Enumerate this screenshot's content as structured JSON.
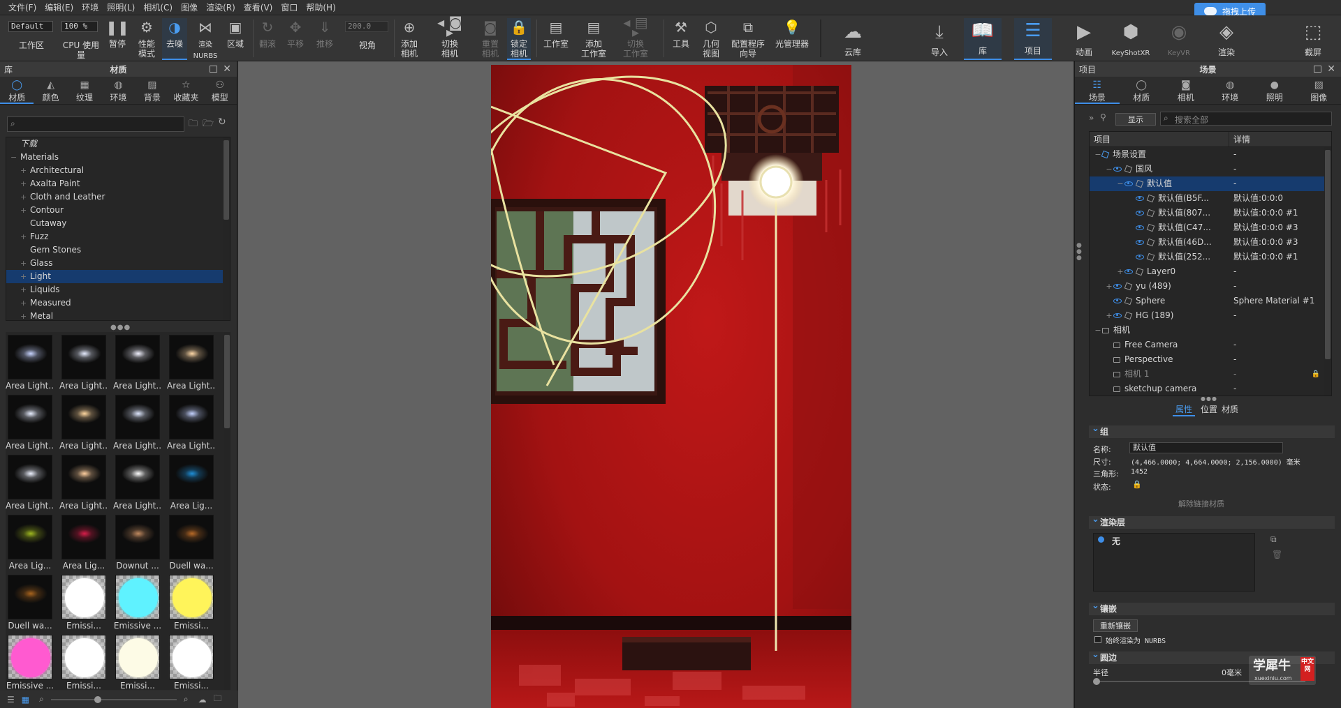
{
  "menu": [
    "文件(F)",
    "编辑(E)",
    "环境",
    "照明(L)",
    "相机(C)",
    "图像",
    "渲染(R)",
    "查看(V)",
    "窗口",
    "帮助(H)"
  ],
  "upload": {
    "label": "拖拽上传"
  },
  "toolbar": {
    "preset": "Default",
    "zoom": "100 %",
    "fov_value": "200.0",
    "items": {
      "workspace": "工作区",
      "cpu": "CPU 使用量",
      "pause": "暂停",
      "perf": "性能\n模式",
      "denoise": "去噪",
      "render_nurbs": "渲染\nNURBS",
      "region": "区域",
      "roll": "翻滚",
      "pan": "平移",
      "push": "推移",
      "fov": "视角",
      "add_cam": "添加\n相机",
      "switch_cam": "切换\n相机",
      "reset_cam": "重置\n相机",
      "lock_cam": "锁定\n相机",
      "studio": "工作室",
      "add_studio": "添加\n工作室",
      "switch_studio": "切换\n工作室",
      "tools": "工具",
      "geo_view": "几何\n视图",
      "config": "配置程序\n向导",
      "light_mgr": "光管理器",
      "cloud": "云库",
      "import": "导入",
      "library": "库",
      "project": "项目",
      "anim": "动画",
      "keyshotxr": "KeyShotXR",
      "keyvr": "KeyVR",
      "render": "渲染",
      "screenshot": "截屏"
    }
  },
  "library": {
    "title": "材质",
    "panel": "库",
    "tabs": [
      "材质",
      "颜色",
      "纹理",
      "环境",
      "背景",
      "收藏夹",
      "模型"
    ],
    "tree": [
      {
        "label": "下载",
        "exp": "",
        "ital": true
      },
      {
        "label": "Materials",
        "exp": "−",
        "ital": false
      },
      {
        "label": "Architectural",
        "exp": "+",
        "indent": 1
      },
      {
        "label": "Axalta Paint",
        "exp": "+",
        "indent": 1
      },
      {
        "label": "Cloth and Leather",
        "exp": "+",
        "indent": 1
      },
      {
        "label": "Contour",
        "exp": "+",
        "indent": 1
      },
      {
        "label": "Cutaway",
        "exp": "",
        "indent": 1
      },
      {
        "label": "Fuzz",
        "exp": "+",
        "indent": 1
      },
      {
        "label": "Gem Stones",
        "exp": "",
        "indent": 1
      },
      {
        "label": "Glass",
        "exp": "+",
        "indent": 1
      },
      {
        "label": "Light",
        "exp": "+",
        "indent": 1,
        "sel": true
      },
      {
        "label": "Liquids",
        "exp": "+",
        "indent": 1
      },
      {
        "label": "Measured",
        "exp": "+",
        "indent": 1
      },
      {
        "label": "Metal",
        "exp": "+",
        "indent": 1
      }
    ],
    "thumbs": [
      {
        "label": "Area Light...",
        "kind": "glow",
        "color": "#c8d4ff"
      },
      {
        "label": "Area Light...",
        "kind": "glow",
        "color": "#e6ecff"
      },
      {
        "label": "Area Light...",
        "kind": "glow",
        "color": "#f2f2ff"
      },
      {
        "label": "Area Light...",
        "kind": "glow",
        "color": "#ffd9a8"
      },
      {
        "label": "Area Light...",
        "kind": "glow",
        "color": "#e8eeff"
      },
      {
        "label": "Area Light...",
        "kind": "glow",
        "color": "#ffd7a0"
      },
      {
        "label": "Area Light...",
        "kind": "glow",
        "color": "#dfe8ff"
      },
      {
        "label": "Area Light...",
        "kind": "glow",
        "color": "#c4d2ff"
      },
      {
        "label": "Area Light...",
        "kind": "glow",
        "color": "#eef2ff"
      },
      {
        "label": "Area Light...",
        "kind": "glow",
        "color": "#ffd0a0"
      },
      {
        "label": "Area Light...",
        "kind": "glow",
        "color": "#ffffff"
      },
      {
        "label": "Area Lig...",
        "kind": "glow",
        "color": "#1f8fd8"
      },
      {
        "label": "Area Lig...",
        "kind": "glow",
        "color": "#9fb820"
      },
      {
        "label": "Area Lig...",
        "kind": "glow",
        "color": "#d81e4a"
      },
      {
        "label": "Downut ...",
        "kind": "glow",
        "color": "#c08a60"
      },
      {
        "label": "Duell wa...",
        "kind": "glow",
        "color": "#b86a28"
      },
      {
        "label": "Duell wa...",
        "kind": "glow",
        "color": "#a8641e"
      },
      {
        "label": "Emissi...",
        "kind": "ball",
        "color": "#ffffff"
      },
      {
        "label": "Emissive ...",
        "kind": "ball",
        "color": "#5ff2ff"
      },
      {
        "label": "Emissi...",
        "kind": "ball",
        "color": "#fff45a"
      },
      {
        "label": "Emissive ...",
        "kind": "ball",
        "color": "#ff5ad0"
      },
      {
        "label": "Emissi...",
        "kind": "ball",
        "color": "#ffffff"
      },
      {
        "label": "Emissi...",
        "kind": "ball",
        "color": "#fdfbe6"
      },
      {
        "label": "Emissi...",
        "kind": "ball",
        "color": "#ffffff"
      }
    ]
  },
  "project": {
    "panel": "项目",
    "title": "场景",
    "tabs": [
      "场景",
      "材质",
      "相机",
      "环境",
      "照明",
      "图像"
    ],
    "display": "显示",
    "search_placeholder": "搜索全部",
    "col1": "项目",
    "col2": "详情",
    "rows": [
      {
        "indent": 0,
        "pm": "−",
        "icon": "scene",
        "label": "场景设置",
        "detail": "-"
      },
      {
        "indent": 1,
        "pm": "−",
        "icon": "eye",
        "label": "国风",
        "detail": "-"
      },
      {
        "indent": 2,
        "pm": "−",
        "icon": "eye",
        "label": "默认值",
        "detail": "-",
        "sel": true
      },
      {
        "indent": 3,
        "pm": "",
        "icon": "eye",
        "label": "默认值(B5F...",
        "detail": "默认值:0:0:0"
      },
      {
        "indent": 3,
        "pm": "",
        "icon": "eye",
        "label": "默认值(807...",
        "detail": "默认值:0:0:0 #1"
      },
      {
        "indent": 3,
        "pm": "",
        "icon": "eye",
        "label": "默认值(C47...",
        "detail": "默认值:0:0:0 #3"
      },
      {
        "indent": 3,
        "pm": "",
        "icon": "eye",
        "label": "默认值(46D...",
        "detail": "默认值:0:0:0 #3"
      },
      {
        "indent": 3,
        "pm": "",
        "icon": "eye",
        "label": "默认值(252...",
        "detail": "默认值:0:0:0 #1"
      },
      {
        "indent": 2,
        "pm": "+",
        "icon": "eye",
        "label": "Layer0",
        "detail": "-"
      },
      {
        "indent": 1,
        "pm": "+",
        "icon": "eye",
        "label": "yu (489)",
        "detail": "-"
      },
      {
        "indent": 1,
        "pm": "",
        "icon": "eye",
        "label": "Sphere",
        "detail": "Sphere Material #1"
      },
      {
        "indent": 1,
        "pm": "+",
        "icon": "eye",
        "label": "HG (189)",
        "detail": "-"
      },
      {
        "indent": 0,
        "pm": "−",
        "icon": "cam",
        "label": "相机",
        "detail": ""
      },
      {
        "indent": 1,
        "pm": "",
        "icon": "cam",
        "label": "Free Camera",
        "detail": "-"
      },
      {
        "indent": 1,
        "pm": "",
        "icon": "cam",
        "label": "Perspective",
        "detail": "-"
      },
      {
        "indent": 1,
        "pm": "",
        "icon": "cam",
        "label": "相机 1",
        "detail": "-",
        "dim": true
      },
      {
        "indent": 1,
        "pm": "",
        "icon": "cam",
        "label": "sketchup camera",
        "detail": "-"
      }
    ],
    "subtabs": [
      "属性",
      "位置",
      "材质"
    ],
    "group": {
      "section": "组",
      "name_label": "名称:",
      "name_value": "默认值",
      "size_label": "尺寸:",
      "size_value": "(4,466.0000; 4,664.0000; 2,156.0000) 毫米",
      "tri_label": "三角形:",
      "tri_value": "1452",
      "state_label": "状态:",
      "unlink": "解除链接材质"
    },
    "render_layer": {
      "section": "渲染层",
      "value": "无"
    },
    "tessellation": {
      "section": "镶嵌",
      "retess": "重新镶嵌",
      "always_nurbs": "始终渲染为 NURBS"
    },
    "rounding": {
      "section": "圆边",
      "radius_label": "半径",
      "radius_value": "0毫米"
    }
  },
  "watermark": {
    "main": "学犀牛",
    "sub": "xuexiniu.com",
    "badge": "中文网"
  },
  "colors": {
    "accent": "#3e8ee8",
    "wall": "#a71313",
    "selected": "#163b6e"
  }
}
